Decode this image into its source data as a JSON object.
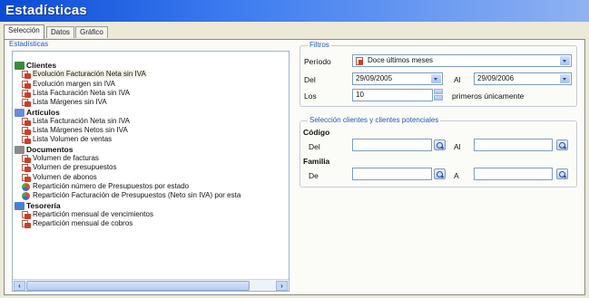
{
  "window": {
    "title": "Estadísticas"
  },
  "tabs": [
    {
      "label": "Selección",
      "active": true
    },
    {
      "label": "Datos",
      "active": false
    },
    {
      "label": "Gráfico",
      "active": false
    }
  ],
  "left_group": {
    "label": "Estadísticas"
  },
  "tree": {
    "categories": [
      {
        "label": "Clientes",
        "icon": "people-icon",
        "items": [
          {
            "label": "Evolución Facturación Neta sin IVA",
            "icon": "report-icon",
            "selected": true
          },
          {
            "label": "Evolución margen sin IVA",
            "icon": "report-icon"
          },
          {
            "label": "Lista Facturación Neta sin IVA",
            "icon": "report-icon"
          },
          {
            "label": "Lista Márgenes sin IVA",
            "icon": "report-icon"
          }
        ]
      },
      {
        "label": "Artículos",
        "icon": "articles-icon",
        "items": [
          {
            "label": "Lista Facturación Neta sin IVA",
            "icon": "report-icon"
          },
          {
            "label": "Lista Márgenes Netos sin IVA",
            "icon": "report-icon"
          },
          {
            "label": "Lista Volumen de ventas",
            "icon": "report-icon"
          }
        ]
      },
      {
        "label": "Documentos",
        "icon": "documents-icon",
        "items": [
          {
            "label": "Volumen de facturas",
            "icon": "report-icon"
          },
          {
            "label": "Volumen de presupuestos",
            "icon": "report-icon"
          },
          {
            "label": "Volumen de abonos",
            "icon": "report-icon"
          },
          {
            "label": "Repartición número de Presupuestos por estado",
            "icon": "pie-chart-icon"
          },
          {
            "label": "Repartición Facturación de Presupuestos (Neto sin IVA) por esta",
            "icon": "pie-chart-icon"
          }
        ]
      },
      {
        "label": "Tesorería",
        "icon": "treasury-icon",
        "items": [
          {
            "label": "Repartición mensual de vencimientos",
            "icon": "report-icon"
          },
          {
            "label": "Repartición mensual de cobros",
            "icon": "report-icon"
          }
        ]
      }
    ]
  },
  "filters": {
    "title": "Filtros",
    "period_label": "Período",
    "period_value": "Doce últimos meses",
    "from_label": "Del",
    "from_value": "29/09/2005",
    "to_label": "Al",
    "to_value": "29/09/2006",
    "top_label": "Los",
    "top_value": "10",
    "top_suffix": "primeros únicamente"
  },
  "client_selection": {
    "title": "Selección clientes y clientes potenciales",
    "code_label": "Código",
    "code_from_label": "Del",
    "code_from_value": "",
    "code_to_label": "Al",
    "code_to_value": "",
    "family_label": "Familia",
    "family_from_label": "De",
    "family_from_value": "",
    "family_to_label": "A",
    "family_to_value": ""
  },
  "colors": {
    "title_bar": "#0a4bd6",
    "group_title": "#2458b6",
    "report_icon": "#d23b25"
  }
}
